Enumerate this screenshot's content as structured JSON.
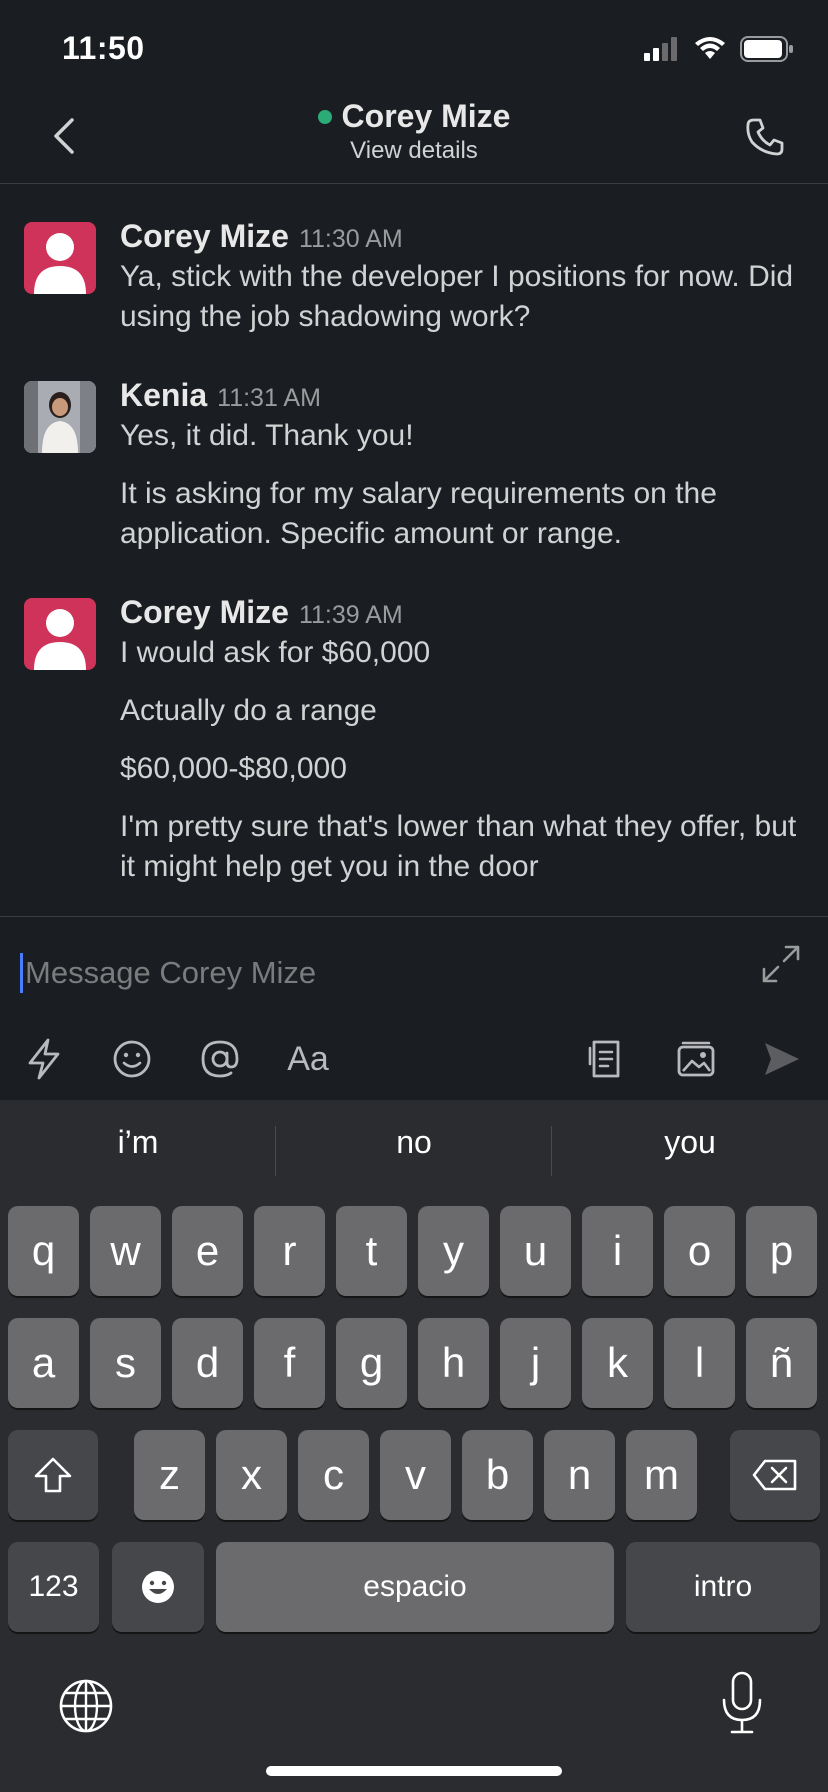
{
  "status_bar": {
    "time": "11:50"
  },
  "header": {
    "title": "Corey Mize",
    "subtitle": "View details",
    "presence": "online"
  },
  "messages": [
    {
      "author": "Corey Mize",
      "time": "11:30 AM",
      "avatar": "default-user-avatar",
      "lines": [
        "Ya, stick with the developer I positions for now. Did using the job shadowing work?"
      ]
    },
    {
      "author": "Kenia",
      "time": "11:31 AM",
      "avatar": "photo-avatar",
      "lines": [
        "Yes, it did. Thank you!",
        "It is asking for my salary requirements on the application. Specific amount or range."
      ]
    },
    {
      "author": "Corey Mize",
      "time": "11:39 AM",
      "avatar": "default-user-avatar",
      "lines": [
        "I would ask for $60,000",
        "Actually do a range",
        "$60,000-$80,000",
        "I'm pretty sure that's lower than what they offer, but it might help get you in the door"
      ]
    }
  ],
  "composer": {
    "placeholder": "Message Corey Mize",
    "format_label": "Aa"
  },
  "keyboard": {
    "suggestions": [
      "i’m",
      "no",
      "you"
    ],
    "row1": [
      "q",
      "w",
      "e",
      "r",
      "t",
      "y",
      "u",
      "i",
      "o",
      "p"
    ],
    "row2": [
      "a",
      "s",
      "d",
      "f",
      "g",
      "h",
      "j",
      "k",
      "l",
      "ñ"
    ],
    "row3": [
      "z",
      "x",
      "c",
      "v",
      "b",
      "n",
      "m"
    ],
    "numbers_label": "123",
    "space_label": "espacio",
    "return_label": "intro"
  },
  "colors": {
    "background": "#1a1d21",
    "presence": "#2bac76",
    "avatar_default": "#d0335a",
    "caret": "#4a7cff"
  }
}
